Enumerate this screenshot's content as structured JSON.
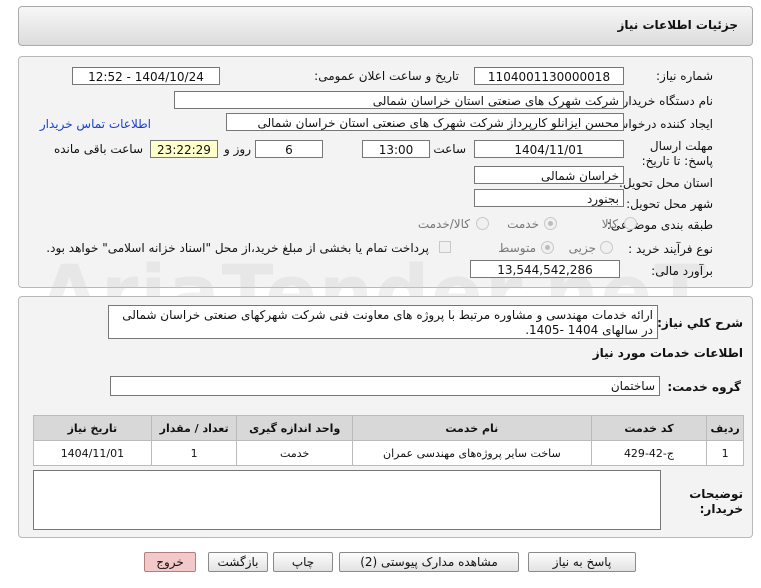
{
  "window_title": "جزئیات اطلاعات نیاز",
  "fields": {
    "need_number_label": "شماره نیاز:",
    "need_number": "1104001130000018",
    "announce_label": "تاریخ و ساعت اعلان عمومی:",
    "announce_value": "1404/10/24 - 12:52",
    "buyer_org_label": "نام دستگاه خریدار:",
    "buyer_org": "شرکت شهرک های صنعتی استان خراسان شمالی",
    "creator_label": "ایجاد کننده درخواست:",
    "creator": "محسن ایزانلو کارپرداز شرکت شهرک های صنعتی استان خراسان شمالی",
    "contact_link": "اطلاعات تماس خریدار",
    "deadline_label": "مهلت ارسال پاسخ: تا تاریخ:",
    "deadline_date": "1404/11/01",
    "time_label": "ساعت",
    "deadline_time": "13:00",
    "days_value": "6",
    "days_label": "روز و",
    "remaining_time": "23:22:29",
    "remaining_label": "ساعت باقی مانده",
    "province_label": "استان محل تحویل:",
    "province": "خراسان شمالی",
    "city_label": "شهر محل تحویل:",
    "city": "بجنورد",
    "category_label": "طبقه بندی موضوعی:",
    "category_options": [
      "کالا",
      "خدمت",
      "کالا/خدمت"
    ],
    "purchase_type_label": "نوع فرآیند خرید :",
    "purchase_options": [
      "جزیی",
      "متوسط"
    ],
    "treasury_note": "پرداخت تمام یا بخشی از مبلغ خرید،از محل \"اسناد خزانه اسلامی\" خواهد بود.",
    "estimate_label": "برآورد مالی:",
    "estimate": "13,544,542,286"
  },
  "description": {
    "label": "شرح کلي نياز:",
    "text": "ارائه خدمات مهندسی و مشاوره مرتبط با پروژه های معاونت فنی شرکت شهرکهای صنعتی خراسان شمالی در سالهای 1404 -1405."
  },
  "services": {
    "section_title": "اطلاعات خدمات مورد نیاز",
    "group_label": "گروه خدمت:",
    "group_value": "ساختمان",
    "columns": [
      "ردیف",
      "کد خدمت",
      "نام خدمت",
      "واحد اندازه گیری",
      "تعداد / مقدار",
      "تاریخ نیاز"
    ],
    "rows": [
      [
        "1",
        "ج-42-429",
        "ساخت سایر پروژه‌های مهندسی عمران",
        "خدمت",
        "1",
        "1404/11/01"
      ]
    ]
  },
  "buyer_notes_label": "توضیحات خریدار:",
  "buttons": {
    "reply": "پاسخ به نیاز",
    "attachments": "مشاهده مدارک پیوستی (2)",
    "print": "چاپ",
    "back": "بازگشت",
    "exit": "خروج"
  },
  "watermark": "AriaTender.neT"
}
